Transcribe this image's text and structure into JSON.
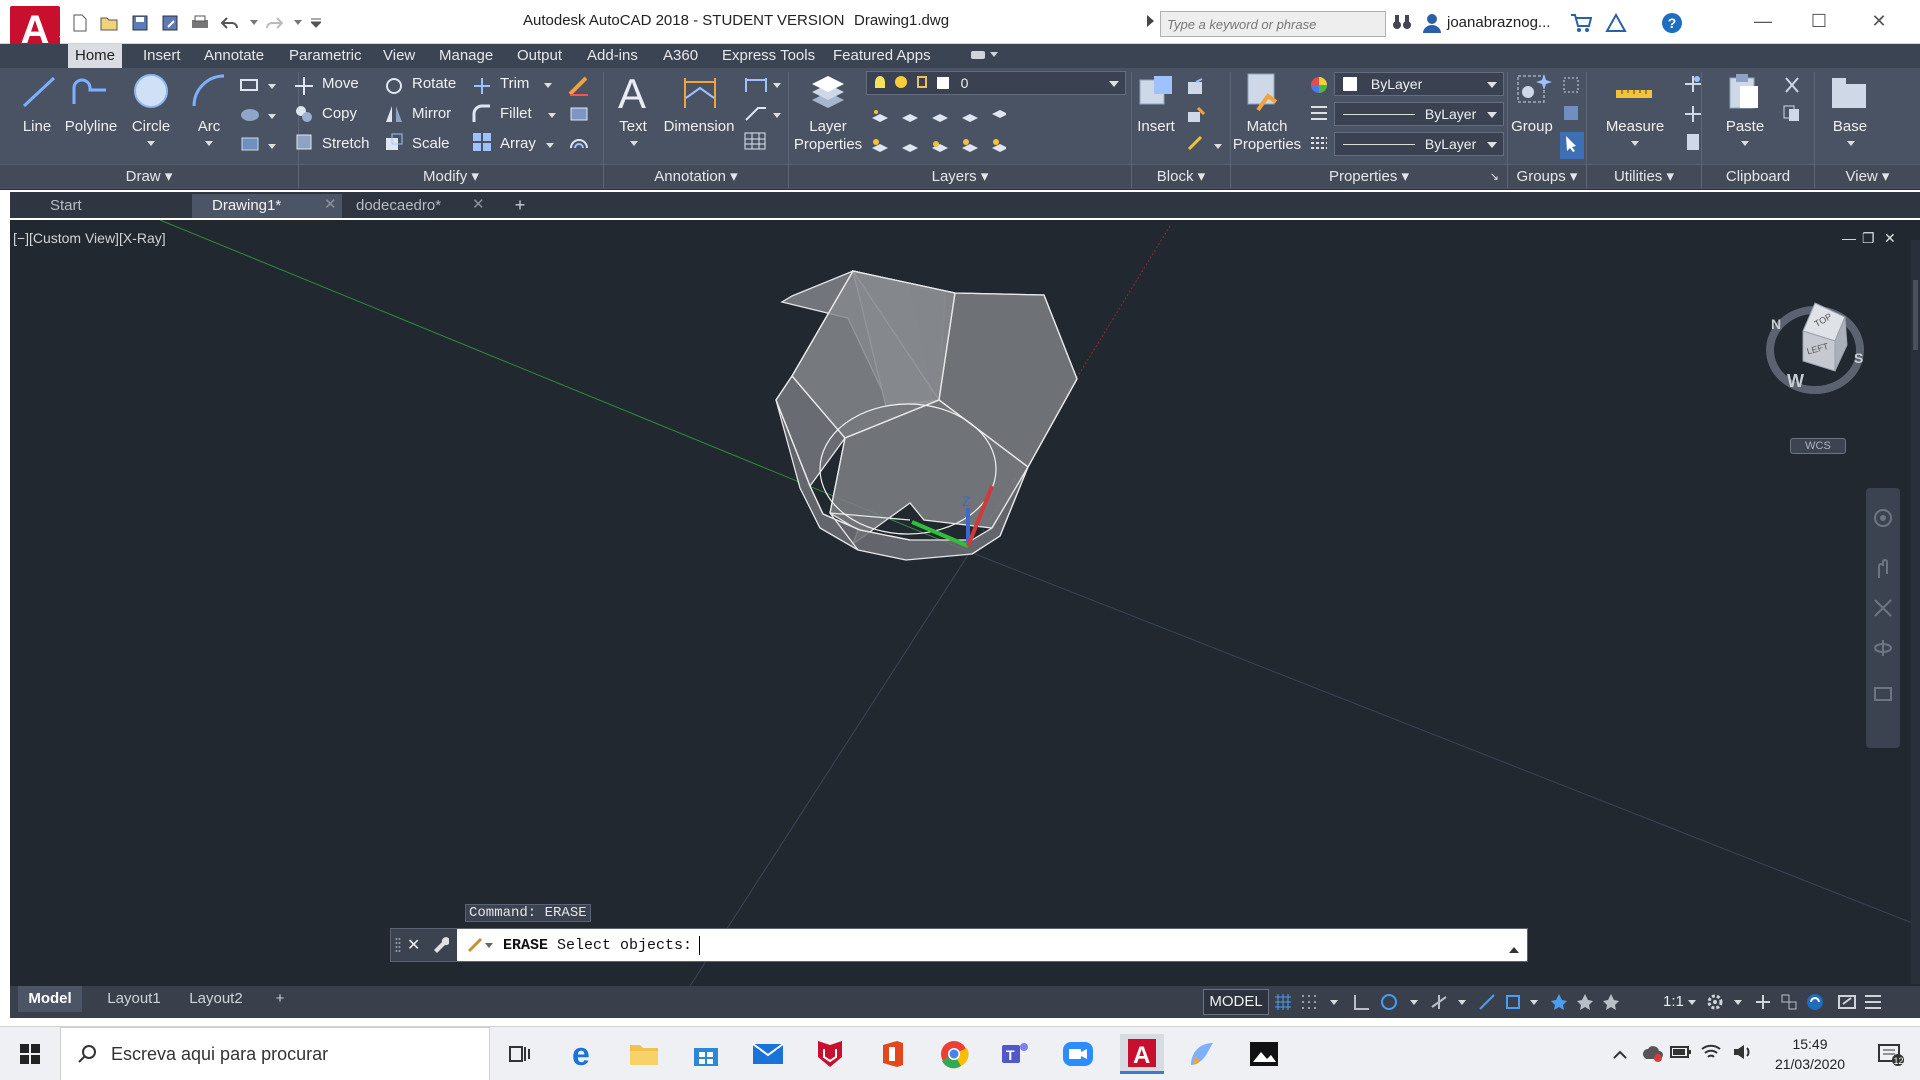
{
  "window": {
    "title": "Autodesk AutoCAD 2018 - STUDENT VERSION",
    "file": "Drawing1.dwg",
    "search_placeholder": "Type a keyword or phrase",
    "user": "joanabraznog...",
    "help": "?"
  },
  "app_logo": "A",
  "ribbon_tabs": [
    "Home",
    "Insert",
    "Annotate",
    "Parametric",
    "View",
    "Manage",
    "Output",
    "Add-ins",
    "A360",
    "Express Tools",
    "Featured Apps"
  ],
  "ribbon": {
    "draw": {
      "line": "Line",
      "polyline": "Polyline",
      "circle": "Circle",
      "arc": "Arc",
      "footer": "Draw"
    },
    "modify": {
      "move": "Move",
      "rotate": "Rotate",
      "trim": "Trim",
      "copy": "Copy",
      "mirror": "Mirror",
      "fillet": "Fillet",
      "stretch": "Stretch",
      "scale": "Scale",
      "array": "Array",
      "footer": "Modify"
    },
    "annotation": {
      "text": "Text",
      "dimension": "Dimension",
      "footer": "Annotation"
    },
    "layers": {
      "layer_properties_1": "Layer",
      "layer_properties_2": "Properties",
      "current_layer": "0",
      "footer": "Layers"
    },
    "block": {
      "insert": "Insert",
      "footer": "Block"
    },
    "properties": {
      "match_1": "Match",
      "match_2": "Properties",
      "color": "ByLayer",
      "linetype": "ByLayer",
      "lineweight": "ByLayer",
      "footer": "Properties"
    },
    "groups": {
      "group": "Group",
      "footer": "Groups"
    },
    "utilities": {
      "measure": "Measure",
      "footer": "Utilities"
    },
    "clipboard": {
      "paste": "Paste",
      "footer": "Clipboard"
    },
    "view": {
      "base": "Base",
      "footer": "View"
    }
  },
  "file_tabs": [
    {
      "label": "Start"
    },
    {
      "label": "Drawing1*"
    },
    {
      "label": "dodecaedro*"
    }
  ],
  "file_tab_add": "+",
  "viewport": {
    "label": "[−][Custom View][X-Ray]",
    "viewcube_top": "TOP",
    "viewcube_left": "LEFT",
    "compass_n": "N",
    "compass_s": "S",
    "compass_w": "W",
    "wcs": "WCS",
    "ucs_z": "Z"
  },
  "command": {
    "history": "Command: ERASE",
    "prompt_cmd": "ERASE",
    "prompt_text": " Select objects: "
  },
  "layout_tabs": [
    "Model",
    "Layout1",
    "Layout2"
  ],
  "layout_add": "+",
  "status": {
    "model": "MODEL",
    "scale": "1:1"
  },
  "taskbar": {
    "search": "Escreva aqui para procurar",
    "time": "15:49",
    "date": "21/03/2020",
    "notifications": "12"
  },
  "colors": {
    "accent": "#c8102e",
    "ribbon_bg": "#4a5363",
    "viewport_bg": "#212830"
  }
}
